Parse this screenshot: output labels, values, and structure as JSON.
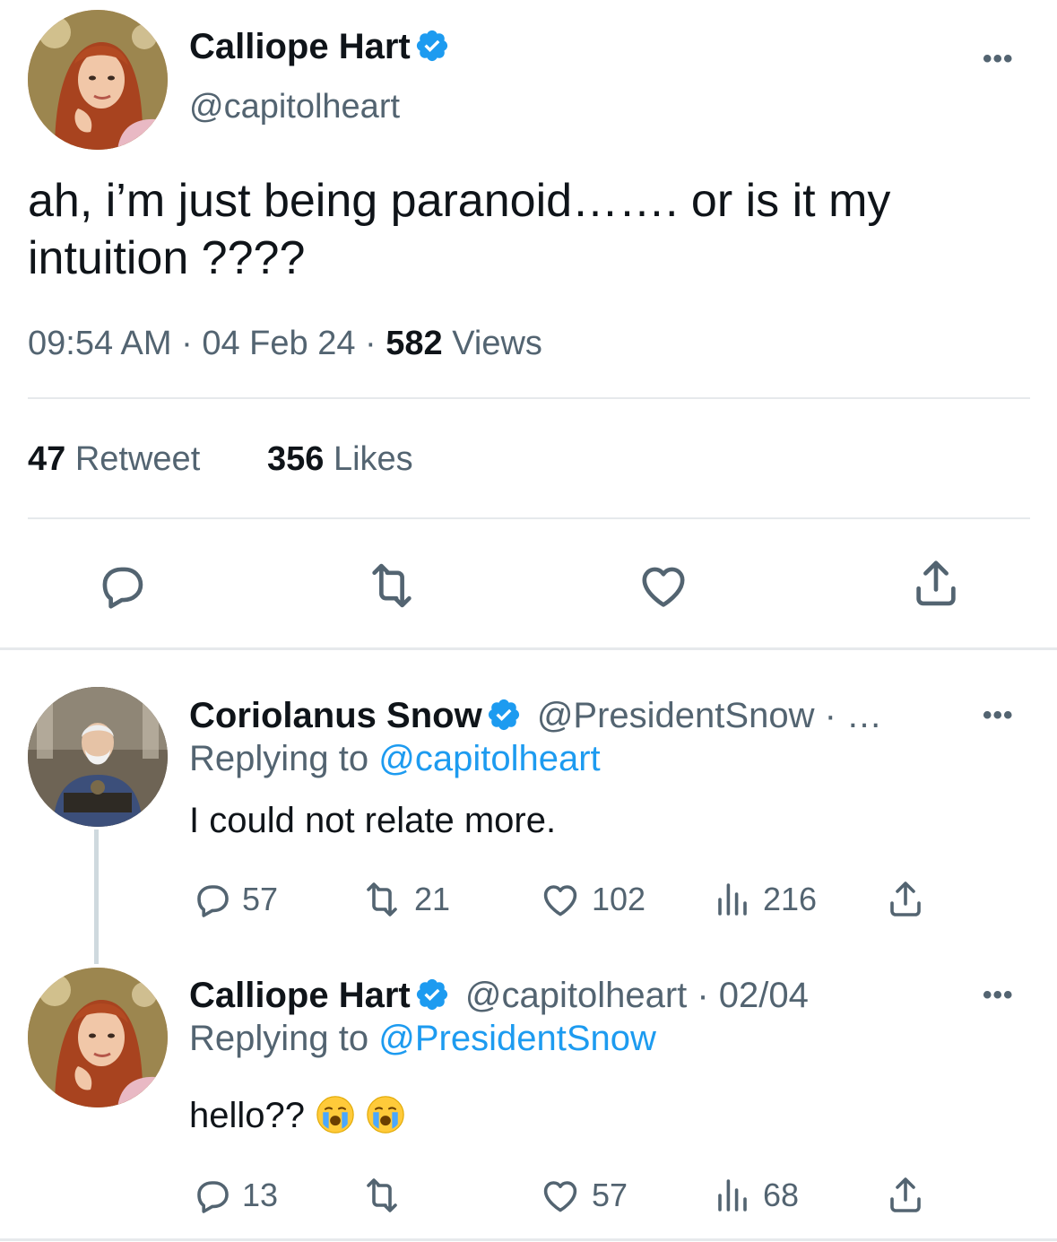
{
  "main_tweet": {
    "author_name": "Calliope Hart",
    "author_handle": "@capitolheart",
    "text": "ah, i’m just being paranoid……. or is it my intuition ????",
    "time": "09:54 AM",
    "date": "04 Feb 24",
    "views_count": "582",
    "views_label": "Views",
    "retweet_count": "47",
    "retweet_label": "Retweet",
    "likes_count": "356",
    "likes_label": "Likes",
    "more_label": "•••"
  },
  "replies": [
    {
      "author_name": "Coriolanus Snow",
      "author_handle": "@PresidentSnow · …",
      "replying_prefix": "Replying to",
      "replying_to": "@capitolheart",
      "text": "I could not relate more.",
      "reply_count": "57",
      "retweet_count": "21",
      "like_count": "102",
      "view_count": "216",
      "more_label": "•••"
    },
    {
      "author_name": "Calliope Hart",
      "author_handle": "@capitolheart · 02/04",
      "replying_prefix": "Replying to",
      "replying_to": "@PresidentSnow",
      "text": "hello??",
      "reply_count": "13",
      "retweet_count": "",
      "like_count": "57",
      "view_count": "68",
      "more_label": "•••"
    }
  ],
  "colors": {
    "accent": "#1d9bf0",
    "text": "#0f1419",
    "secondary": "#536471",
    "divider": "#e6e9ec"
  },
  "icons": [
    "verified-badge-icon",
    "reply-icon",
    "retweet-icon",
    "like-icon",
    "share-icon",
    "views-icon",
    "more-icon",
    "crying-face-emoji"
  ]
}
